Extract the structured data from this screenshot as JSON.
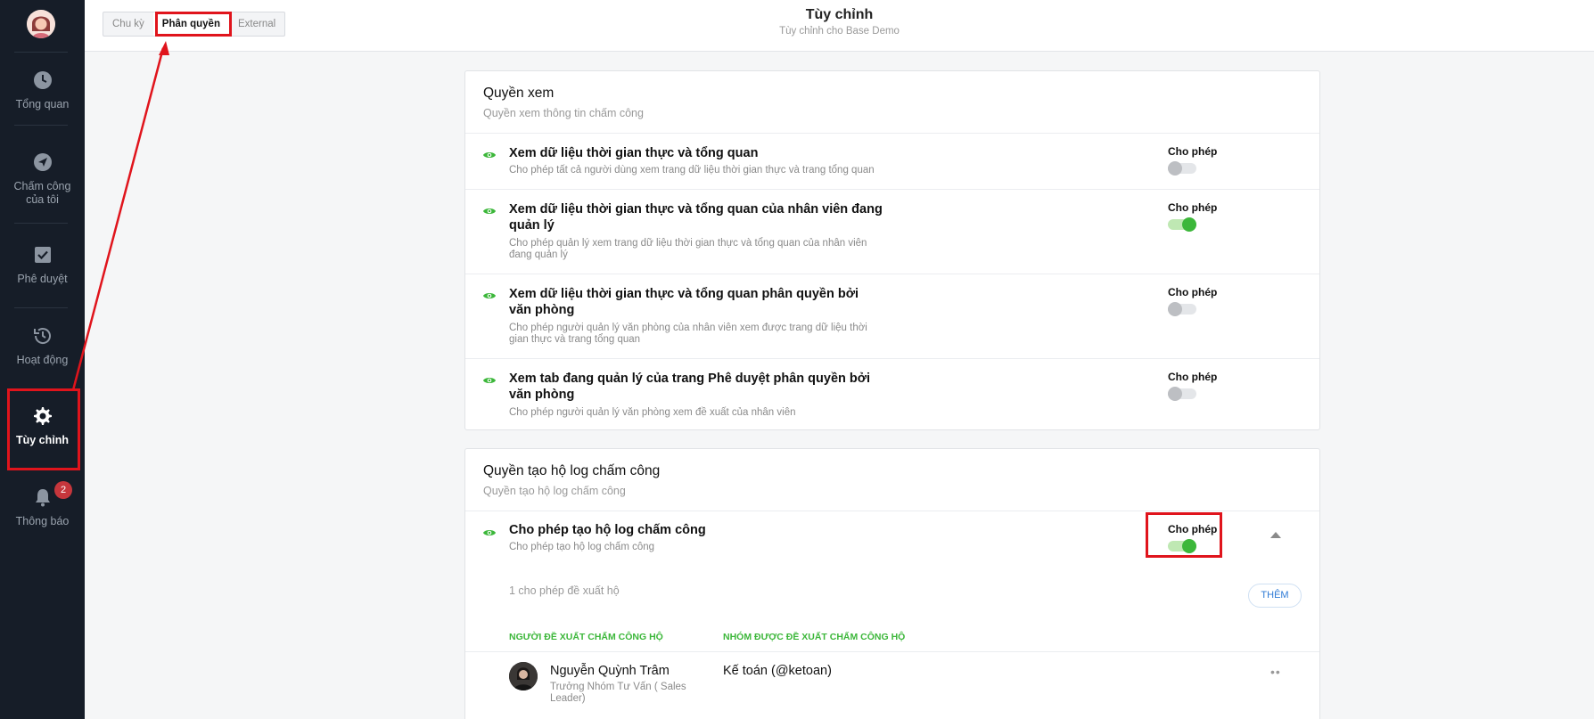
{
  "sidebar": {
    "items": [
      {
        "label": "Tổng quan",
        "icon": "clock-icon"
      },
      {
        "label": "Chấm công của tôi",
        "icon": "send-icon"
      },
      {
        "label": "Phê duyệt",
        "icon": "checkbox-icon"
      },
      {
        "label": "Hoạt động",
        "icon": "history-icon"
      },
      {
        "label": "Tùy chỉnh",
        "icon": "gear-icon"
      },
      {
        "label": "Thông báo",
        "icon": "bell-icon"
      }
    ],
    "notification_badge": "2"
  },
  "header": {
    "tabs": [
      "Chu kỳ",
      "Phân quyền",
      "External"
    ],
    "active_tab": "Phân quyền",
    "title": "Tùy chỉnh",
    "subtitle": "Tùy chỉnh cho Base Demo"
  },
  "view_section": {
    "title": "Quyền xem",
    "desc": "Quyền xem thông tin chấm công",
    "rows": [
      {
        "title": "Xem dữ liệu thời gian thực và tổng quan",
        "desc": "Cho phép tất cả người dùng xem trang dữ liệu thời gian thực và trang tổng quan",
        "perm_label": "Cho phép",
        "enabled": false
      },
      {
        "title": "Xem dữ liệu thời gian thực và tổng quan của nhân viên đang quản lý",
        "desc": "Cho phép quản lý xem trang dữ liệu thời gian thực và tổng quan của nhân viên đang quản lý",
        "perm_label": "Cho phép",
        "enabled": true
      },
      {
        "title": "Xem dữ liệu thời gian thực và tổng quan phân quyền bởi văn phòng",
        "desc": "Cho phép người quản lý văn phòng của nhân viên xem được trang dữ liệu thời gian thực và trang tổng quan",
        "perm_label": "Cho phép",
        "enabled": false
      },
      {
        "title": "Xem tab đang quản lý của trang Phê duyệt phân quyền bởi văn phòng",
        "desc": "Cho phép người quản lý văn phòng xem đề xuất của nhân viên",
        "perm_label": "Cho phép",
        "enabled": false
      }
    ]
  },
  "log_section": {
    "title": "Quyền tạo hộ log chấm công",
    "desc": "Quyền tạo hộ log chấm công",
    "row": {
      "title": "Cho phép tạo hộ log chấm công",
      "desc": "Cho phép tạo hộ log chấm công",
      "perm_label": "Cho phép",
      "enabled": true
    },
    "count_text": "1 cho phép đề xuất hộ",
    "add_label": "THÊM",
    "columns": [
      "NGƯỜI ĐỀ XUẤT CHẤM CÔNG HỘ",
      "NHÓM ĐƯỢC ĐỀ XUẤT CHẤM CÔNG HỘ"
    ],
    "entries": [
      {
        "name": "Nguyễn Quỳnh Trâm",
        "role": "Trưởng Nhóm Tư Vấn ( Sales Leader)",
        "group": "Kế toán (@ketoan)"
      }
    ]
  },
  "colors": {
    "accent_green": "#3cb73a",
    "annotation_red": "#e0141c",
    "sidebar_bg": "#161d28",
    "link_blue": "#2f7bd6"
  }
}
